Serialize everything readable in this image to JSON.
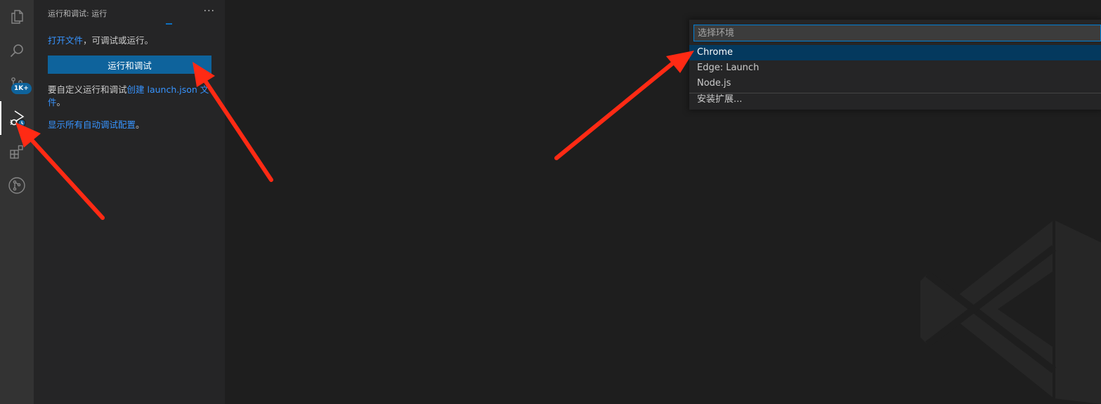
{
  "activity_bar": {
    "items": [
      {
        "icon": "files-icon"
      },
      {
        "icon": "search-icon"
      },
      {
        "icon": "source-control-icon",
        "badge": "1K+"
      },
      {
        "icon": "run-debug-icon",
        "active": true
      },
      {
        "icon": "extensions-icon"
      },
      {
        "icon": "git-graph-icon"
      }
    ]
  },
  "sidebar": {
    "title": "运行和调试: 运行",
    "more": "···",
    "open_file_link": "打开文件",
    "open_file_suffix": "，可调试或运行。",
    "run_button": "运行和调试",
    "customize_prefix": "要自定义运行和调试",
    "customize_link": "创建 launch.json 文",
    "customize_link_line2": "件",
    "customize_suffix": "。",
    "show_configs_link": "显示所有自动调试配置",
    "show_configs_suffix": "。"
  },
  "quick_pick": {
    "placeholder": "选择环境",
    "items": [
      {
        "label": "Chrome",
        "selected": true
      },
      {
        "label": "Edge: Launch",
        "selected": false
      },
      {
        "label": "Node.js",
        "selected": false
      }
    ],
    "install_extensions": "安装扩展..."
  },
  "colors": {
    "activity_bar": "#333333",
    "sidebar": "#252526",
    "editor": "#1e1e1e",
    "accent": "#0e639c",
    "link": "#3794ff",
    "selected_item": "#04395e",
    "arrow": "#ff2a14"
  }
}
